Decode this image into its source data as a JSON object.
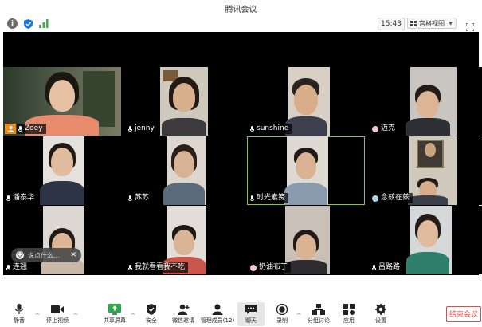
{
  "window": {
    "title": "腾讯会议"
  },
  "topbar": {
    "info_icon": "info-icon",
    "shield_icon": "shield-icon",
    "signal_icon": "signal-icon",
    "meeting_time": "15:43",
    "view_label": "宫格视图",
    "colors": {
      "shield": "#1a73e8",
      "signal": "#3cb043"
    }
  },
  "participants": [
    {
      "name": "Zoey",
      "host": true
    },
    {
      "name": "jenny"
    },
    {
      "name": "sunshine"
    },
    {
      "name": "迈克",
      "special_icon": "heart-avatar"
    },
    {
      "name": "潘泰华"
    },
    {
      "name": "苏苏"
    },
    {
      "name": "时光素笺",
      "active_speaker": true
    },
    {
      "name": "念兹在兹",
      "special_icon": "bubble-avatar"
    },
    {
      "name": "连翘"
    },
    {
      "name": "我就看看我不吃"
    },
    {
      "name": "奶油布丁",
      "special_icon": "heart-avatar"
    },
    {
      "name": "吕路路"
    }
  ],
  "chat_popup": {
    "placeholder": "说点什么..."
  },
  "toolbar": {
    "items": [
      {
        "label": "静音",
        "icon": "microphone-icon"
      },
      {
        "label": "停止视频",
        "icon": "video-camera-icon"
      },
      {
        "label": "共享屏幕",
        "icon": "share-screen-icon"
      },
      {
        "label": "安全",
        "icon": "shield-icon"
      },
      {
        "label": "微信邀请",
        "icon": "invite-icon"
      },
      {
        "label": "管理成员(12)",
        "icon": "members-icon"
      },
      {
        "label": "聊天",
        "icon": "chat-icon"
      },
      {
        "label": "录制",
        "icon": "record-icon"
      },
      {
        "label": "分组讨论",
        "icon": "breakout-icon"
      },
      {
        "label": "应用",
        "icon": "apps-icon"
      },
      {
        "label": "设置",
        "icon": "gear-icon"
      }
    ],
    "end_label": "结束会议",
    "colors": {
      "share": "#2ba84a",
      "end": "#e24b4b"
    }
  }
}
